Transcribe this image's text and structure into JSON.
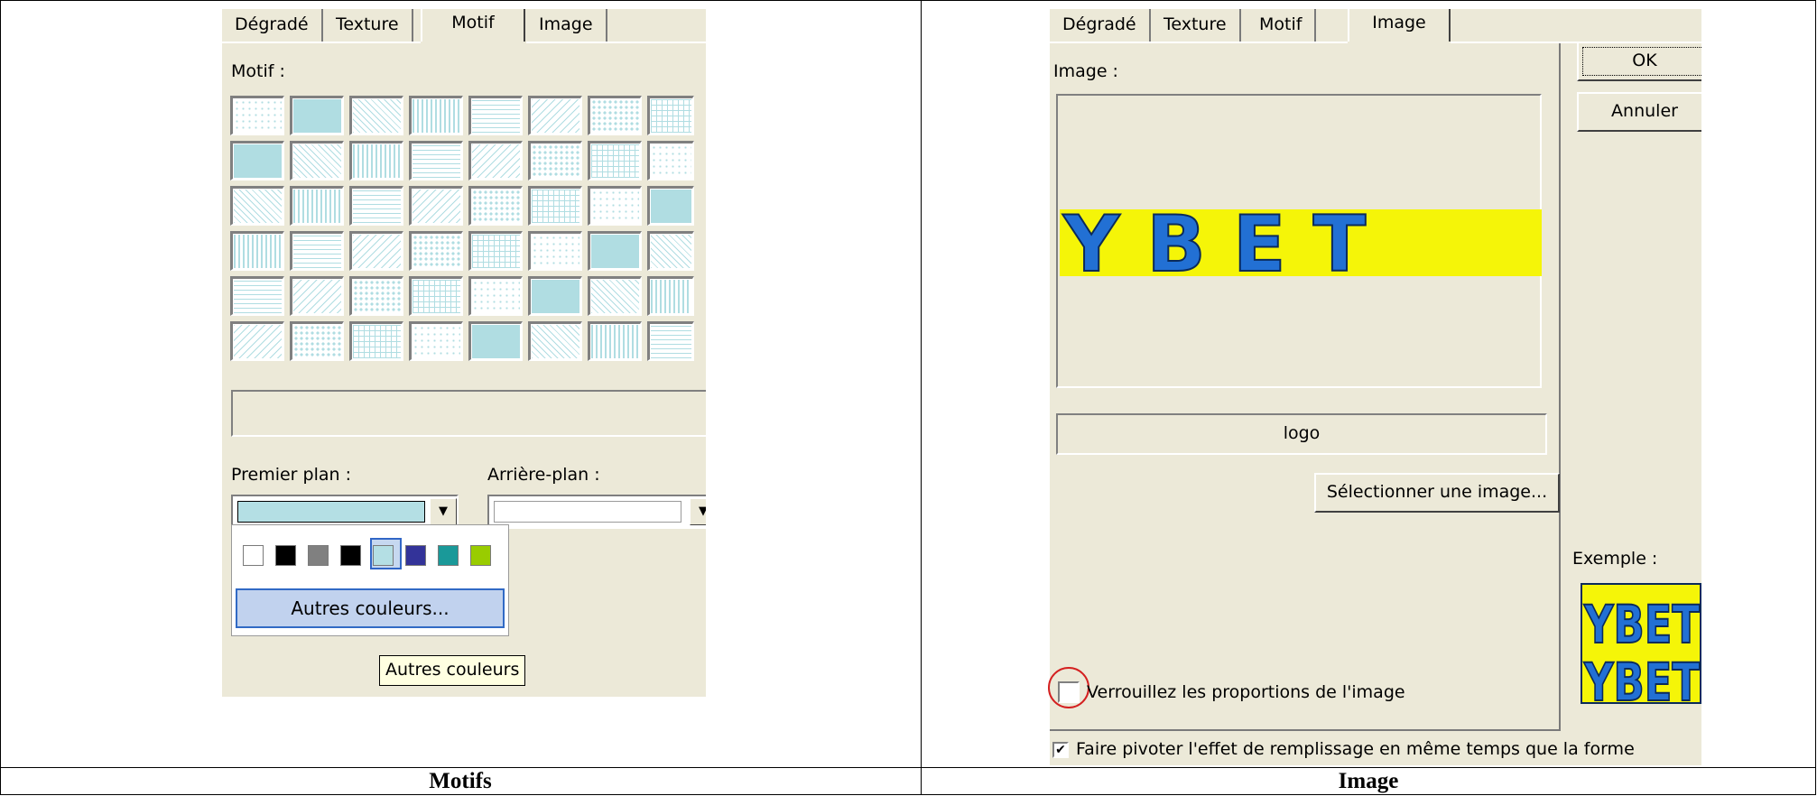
{
  "captions": {
    "left": "Motifs",
    "right": "Image"
  },
  "motifs_dialog": {
    "tabs": [
      "Dégradé",
      "Texture",
      "Motif",
      "Image"
    ],
    "active_tab": "Motif",
    "motif_label": "Motif :",
    "pattern_color": "#b0dde2",
    "pattern_rows": 6,
    "pattern_cols": 8,
    "foreground_label": "Premier plan :",
    "background_label": "Arrière-plan :",
    "foreground_value_color": "#b4dfe4",
    "swatches": [
      "#ffffff",
      "#000000",
      "#808080",
      "#000000",
      "#b4dfe4",
      "#333399",
      "#1a9999",
      "#99cc00"
    ],
    "selected_swatch": 4,
    "more_colors_button": "Autres couleurs...",
    "tooltip": "Autres couleurs"
  },
  "image_dialog": {
    "tabs": [
      "Dégradé",
      "Texture",
      "Motif",
      "Image"
    ],
    "active_tab": "Image",
    "image_label": "Image :",
    "logo_text": "YBET",
    "file_name": "logo",
    "select_button": "Sélectionner une image...",
    "ok_button": "OK",
    "cancel_button": "Annuler",
    "example_label": "Exemple :",
    "lock_proportions_label": "Verrouillez les proportions de l'image",
    "lock_proportions_checked": false,
    "rotate_label": "Faire pivoter l'effet de remplissage en même temps que la forme",
    "rotate_checked": true
  }
}
